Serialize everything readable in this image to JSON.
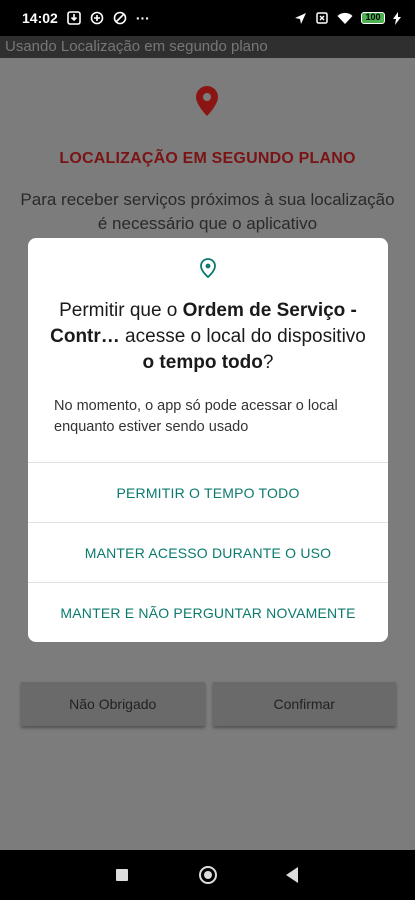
{
  "status_bar": {
    "time": "14:02",
    "more": "···",
    "battery_level": "100"
  },
  "app_bar": {
    "title": "Usando Localização em segundo plano"
  },
  "background": {
    "heading": "LOCALIZAÇÃO EM SEGUNDO PLANO",
    "description": "Para receber serviços próximos à sua localização é necessário que o aplicativo",
    "buttons": {
      "decline": "Não Obrigado",
      "confirm": "Confirmar"
    }
  },
  "dialog": {
    "title_prefix": "Permitir que o ",
    "title_app": "Ordem de Serviço - Contr…",
    "title_middle": " acesse o local do dispositivo ",
    "title_emphasis": "o tempo todo",
    "title_suffix": "?",
    "message": "No momento, o app só pode acessar o local enquanto estiver sendo usado",
    "actions": {
      "allow_all_the_time": "PERMITIR O TEMPO TODO",
      "keep_while_using": "MANTER ACESSO DURANTE O USO",
      "keep_dont_ask": "MANTER E NÃO PERGUNTAR NOVAMENTE"
    }
  },
  "icons": {
    "bg_pin": "location-pin-icon",
    "dialog_pin": "location-outline-icon"
  },
  "colors": {
    "accent_teal": "#0b7a6e",
    "heading_red": "#7a1414",
    "pin_red": "#8b1515"
  }
}
